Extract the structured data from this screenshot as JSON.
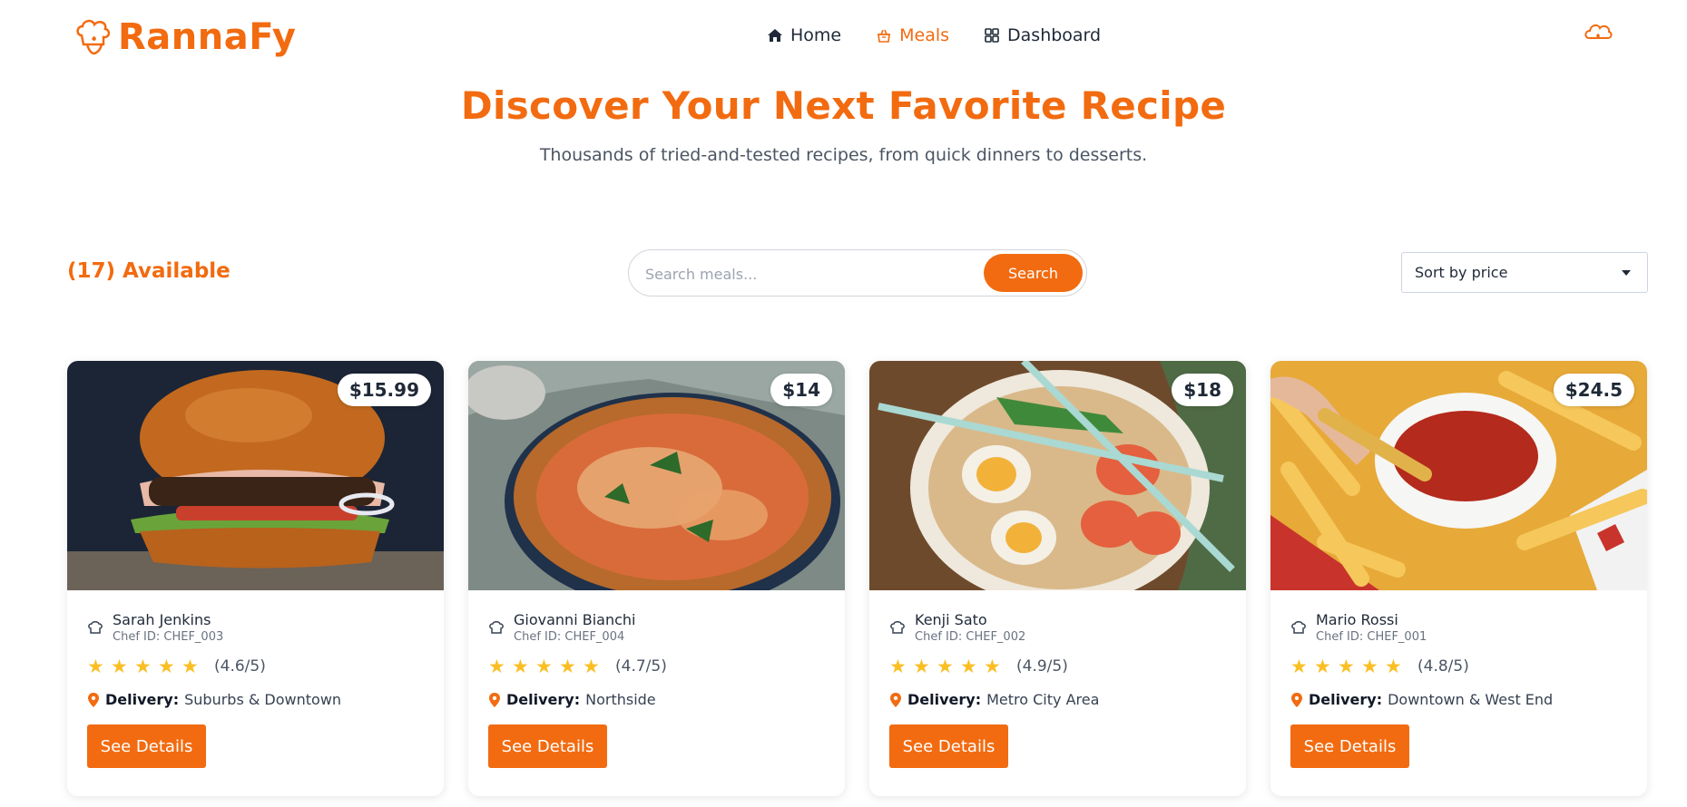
{
  "brand": {
    "name": "RannaFy",
    "accent": "#f26b10"
  },
  "nav": {
    "items": [
      {
        "label": "Home",
        "icon": "home-icon",
        "active": false
      },
      {
        "label": "Meals",
        "icon": "basket-icon",
        "active": true
      },
      {
        "label": "Dashboard",
        "icon": "grid-icon",
        "active": false
      }
    ],
    "right_icon": "cloud-flame-icon"
  },
  "hero": {
    "title": "Discover Your Next Favorite Recipe",
    "subtitle": "Thousands of tried-and-tested recipes, from quick dinners to desserts."
  },
  "toolbar": {
    "available_label": "(17) Available",
    "search_placeholder": "Search meals...",
    "search_value": "",
    "search_button": "Search",
    "sort_selected": "Sort by price"
  },
  "meals": [
    {
      "price": "$15.99",
      "chef_name": "Sarah Jenkins",
      "chef_id": "Chef ID: CHEF_003",
      "rating_text": "(4.6/5)",
      "stars": 5,
      "delivery_label": "Delivery:",
      "delivery_value": "Suburbs & Downtown",
      "button": "See Details",
      "image": "burger"
    },
    {
      "price": "$14",
      "chef_name": "Giovanni Bianchi",
      "chef_id": "Chef ID: CHEF_004",
      "rating_text": "(4.7/5)",
      "stars": 5,
      "delivery_label": "Delivery:",
      "delivery_value": "Northside",
      "button": "See Details",
      "image": "pizza"
    },
    {
      "price": "$18",
      "chef_name": "Kenji Sato",
      "chef_id": "Chef ID: CHEF_002",
      "rating_text": "(4.9/5)",
      "stars": 5,
      "delivery_label": "Delivery:",
      "delivery_value": "Metro City Area",
      "button": "See Details",
      "image": "ramen"
    },
    {
      "price": "$24.5",
      "chef_name": "Mario Rossi",
      "chef_id": "Chef ID: CHEF_001",
      "rating_text": "(4.8/5)",
      "stars": 5,
      "delivery_label": "Delivery:",
      "delivery_value": "Downtown & West End",
      "button": "See Details",
      "image": "fries"
    }
  ]
}
